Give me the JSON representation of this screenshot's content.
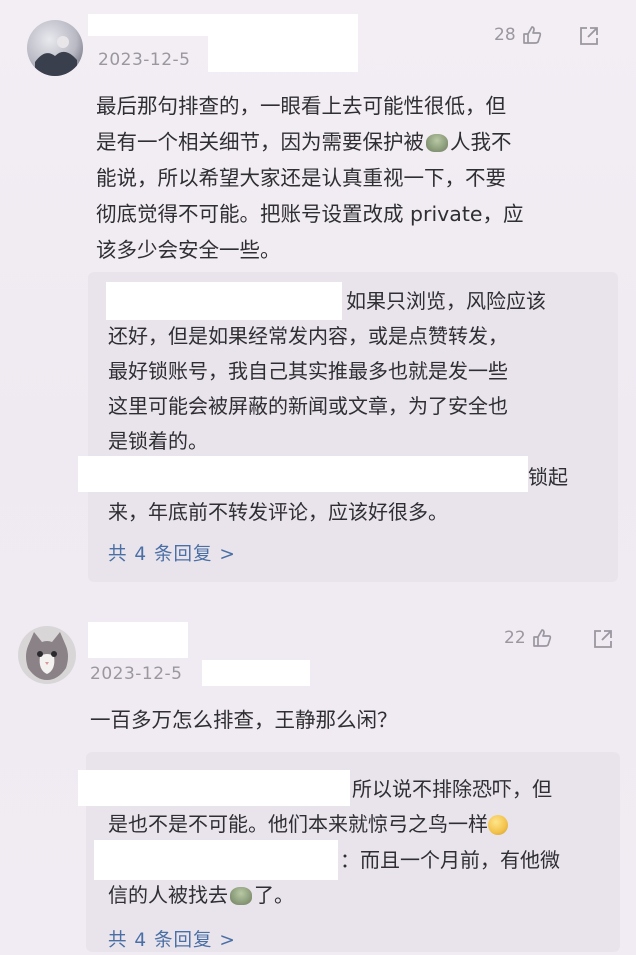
{
  "comments": [
    {
      "date": "2023-12-5",
      "likes": "28",
      "text_lines": [
        "最后那句排查的，一眼看上去可能性很低，但",
        "是有一个相关细节，因为需要保护被",
        "人我不",
        "能说，所以希望大家还是认真重视一下，不要",
        "彻底觉得不可能。把账号设置改成 private，应",
        "该多少会安全一些。"
      ],
      "replies": [
        [
          "如果只浏览，风险应该",
          "还好，但是如果经常发内容，或是点赞转发，",
          "最好锁账号，我自己其实推最多也就是发一些",
          "这里可能会被屏蔽的新闻或文章，为了安全也",
          "是锁着的。"
        ],
        [
          "锁起",
          "来，年底前不转发评论，应该好很多。"
        ]
      ],
      "more": "共 4 条回复 >"
    },
    {
      "date": "2023-12-5",
      "likes": "22",
      "text": "一百多万怎么排查，王静那么闲？",
      "replies": [
        [
          "所以说不排除恐吓，但",
          "是也不是不可能。他们本来就惊弓之鸟一样"
        ],
        [
          "：而且一个月前，有他微",
          "信的人被找去",
          "了。"
        ]
      ],
      "more": "共 4 条回复 >"
    }
  ],
  "icons": {
    "like": "thumbs-up-icon",
    "share": "share-icon"
  }
}
